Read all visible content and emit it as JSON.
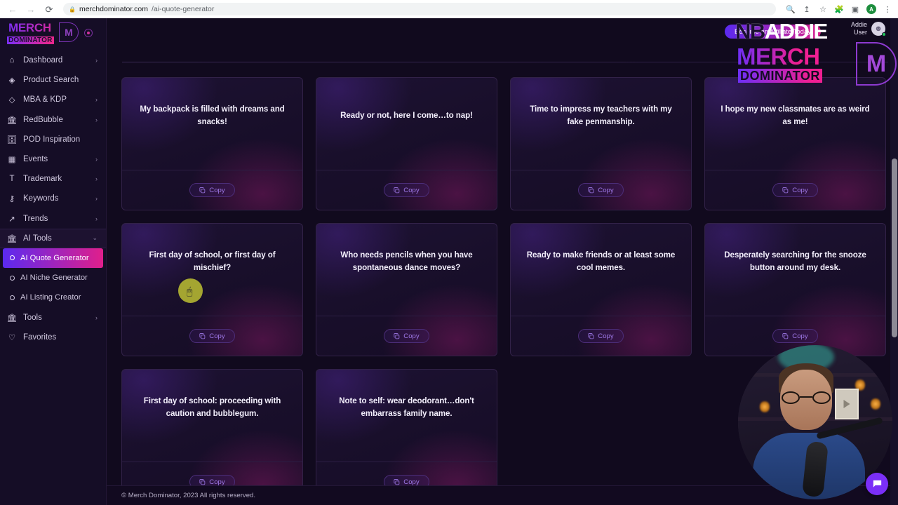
{
  "browser": {
    "back_icon": "back-arrow-icon",
    "forward_icon": "forward-arrow-icon",
    "reload_icon": "reload-icon",
    "lock_icon": "lock-icon",
    "url_host": "merchdominator.com",
    "url_path": "/ai-quote-generator",
    "toolbar_icons": [
      "search-icon",
      "share-icon",
      "bookmark-star-icon",
      "extensions-puzzle-icon",
      "side-panel-icon"
    ],
    "profile_initial": "A",
    "menu_icon": "kebab-menu-icon"
  },
  "sidebar": {
    "brand": {
      "merch": "MERCH",
      "dominator": "DOMINATOR",
      "monogram": "M"
    },
    "collapse_icon": "collapse-toggle-icon",
    "items": [
      {
        "label": "Dashboard",
        "icon": "home-icon",
        "chevron": "›"
      },
      {
        "label": "Product Search",
        "icon": "compass-icon",
        "chevron": ""
      },
      {
        "label": "MBA & KDP",
        "icon": "box-icon",
        "chevron": "›"
      },
      {
        "label": "RedBubble",
        "icon": "shop-icon",
        "chevron": "›"
      },
      {
        "label": "POD Inspiration",
        "icon": "database-icon",
        "chevron": ""
      },
      {
        "label": "Events",
        "icon": "calendar-icon",
        "chevron": "›"
      },
      {
        "label": "Trademark",
        "icon": "type-t-icon",
        "chevron": "›"
      },
      {
        "label": "Keywords",
        "icon": "key-icon",
        "chevron": "›"
      },
      {
        "label": "Trends",
        "icon": "trend-up-icon",
        "chevron": "›"
      }
    ],
    "ai_tools": {
      "label": "AI Tools",
      "icon": "shop-icon",
      "chevron": "⌄"
    },
    "ai_sub_items": [
      {
        "label": "AI Quote Generator",
        "active": true
      },
      {
        "label": "AI Niche Generator",
        "active": false
      },
      {
        "label": "AI Listing Creator",
        "active": false
      }
    ],
    "bottom_items": [
      {
        "label": "Tools",
        "icon": "shop-icon",
        "chevron": "›"
      },
      {
        "label": "Favorites",
        "icon": "heart-icon",
        "chevron": ""
      }
    ]
  },
  "header": {
    "affiliate_button": "Become an Affiliate Today",
    "user_name_line1": "Addie",
    "user_name_line2": "User",
    "avatar_icon": "user-avatar-icon"
  },
  "quotes": [
    {
      "text": "My backpack is filled with dreams and snacks!",
      "copy_label": "Copy"
    },
    {
      "text": "Ready or not, here I come…to nap!",
      "copy_label": "Copy"
    },
    {
      "text": "Time to impress my teachers with my fake penmanship.",
      "copy_label": "Copy"
    },
    {
      "text": "I hope my new classmates are as weird as me!",
      "copy_label": "Copy"
    },
    {
      "text": "First day of school, or first day of mischief?",
      "copy_label": "Copy"
    },
    {
      "text": "Who needs pencils when you have spontaneous dance moves?",
      "copy_label": "Copy"
    },
    {
      "text": "Ready to make friends or at least some cool memes.",
      "copy_label": "Copy"
    },
    {
      "text": "Desperately searching for the snooze button around my desk.",
      "copy_label": "Copy"
    },
    {
      "text": "First day of school: proceeding with caution and bubblegum.",
      "copy_label": "Copy"
    },
    {
      "text": "Note to self: wear deodorant…don't embarrass family name.",
      "copy_label": "Copy"
    }
  ],
  "footer": {
    "copyright": "© Merch Dominator, 2023 All rights reserved."
  },
  "overlay": {
    "watermark_addie_nb": "NB",
    "watermark_addie": "ADDIE",
    "watermark_merch": "MERCH",
    "watermark_dominator": "DOMINATOR",
    "watermark_monogram": "M",
    "chat_icon": "chat-bubble-icon",
    "webcam_label": "webcam-overlay"
  },
  "colors": {
    "accent_purple": "#7b2ff7",
    "accent_pink": "#e01f8b",
    "card_bg": "#1a1030",
    "sidebar_bg": "#150d26",
    "page_bg": "#110a1e",
    "copy_text": "#9f79e8",
    "cursor_highlight": "#b0b232"
  }
}
